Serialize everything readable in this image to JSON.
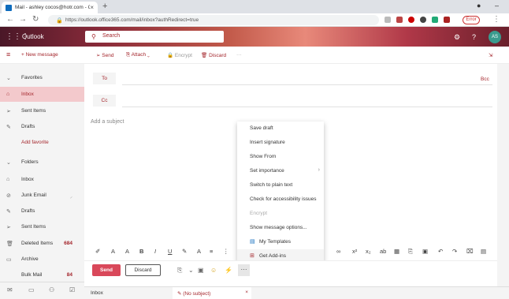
{
  "browser": {
    "tab_title": "Mail - ashley cocos@hotr.com - Ou",
    "new_tab": "+",
    "url": "https://outlook.office365.com/mail/inbox?authRedirect=true",
    "error_label": "Error"
  },
  "header": {
    "app_name": "Outlook",
    "search_placeholder": "Search",
    "avatar_initials": "AS"
  },
  "command_bar": {
    "new_message": "New message",
    "send": "Send",
    "attach": "Attach",
    "encrypt": "Encrypt",
    "discard": "Discard",
    "more": "···"
  },
  "nav": {
    "favorites": "Favorites",
    "folders": "Folders",
    "items": [
      {
        "label": "Inbox",
        "count": ""
      },
      {
        "label": "Sent Items",
        "count": ""
      },
      {
        "label": "Drafts",
        "count": ""
      },
      {
        "label": "Add favorite",
        "count": ""
      },
      {
        "label": "Inbox",
        "count": ""
      },
      {
        "label": "Junk Email",
        "count": ""
      },
      {
        "label": "Drafts",
        "count": ""
      },
      {
        "label": "Sent Items",
        "count": ""
      },
      {
        "label": "Deleted Items",
        "count": "684"
      },
      {
        "label": "Archive",
        "count": ""
      },
      {
        "label": "Bulk Mail",
        "count": "84"
      }
    ]
  },
  "compose": {
    "to_label": "To",
    "cc_label": "Cc",
    "bcc_label": "Bcc",
    "subject_placeholder": "Add a subject"
  },
  "menu": {
    "items": [
      "Save draft",
      "Insert signature",
      "Show From",
      "Set importance",
      "Switch to plain text",
      "Check for accessibility issues",
      "Encrypt",
      "Show message options...",
      "My Templates",
      "Get Add-ins"
    ]
  },
  "send_row": {
    "send": "Send",
    "discard": "Discard"
  },
  "bottom_tabs": {
    "inbox": "Inbox",
    "draft": "(No subject)"
  },
  "colors": {
    "accent": "#a4262c",
    "send_button": "#d9485a",
    "active_nav": "#f3c9cc"
  }
}
